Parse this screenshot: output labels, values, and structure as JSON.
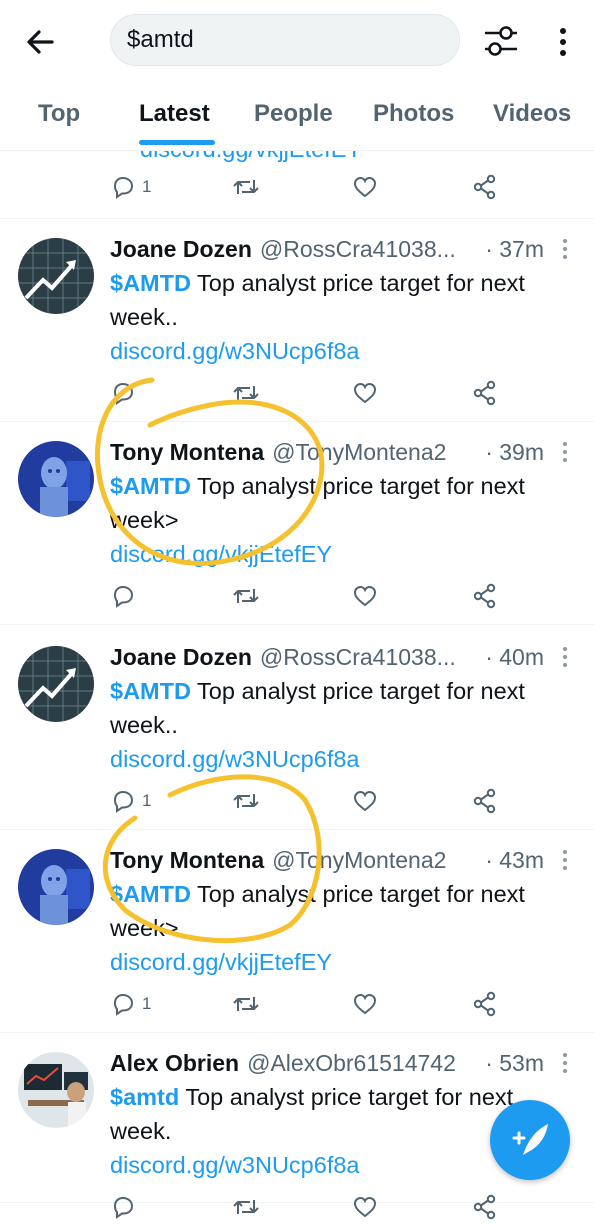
{
  "search": {
    "value": "$amtd"
  },
  "tabs": [
    {
      "label": "Top"
    },
    {
      "label": "Latest",
      "active": true
    },
    {
      "label": "People"
    },
    {
      "label": "Photos"
    },
    {
      "label": "Videos"
    }
  ],
  "colors": {
    "accent": "#1d9bf0",
    "annotation": "#f5c12f",
    "muted": "#536471"
  },
  "partial_tweet": {
    "link": "discord.gg/vkjjEtefEY",
    "reply_count": "1"
  },
  "tweets": [
    {
      "name": "Joane Dozen",
      "handle": "@RossCra41038...",
      "time": "· 37m",
      "cashtag": "$AMTD",
      "text1": " Top analyst price target for next",
      "text2": "week..",
      "link": "discord.gg/w3NUcp6f8a",
      "reply_count": "",
      "avatar_icon": "stock-chart-avatar"
    },
    {
      "name": "Tony Montena",
      "handle": "@TonyMontena2",
      "time": "· 39m",
      "cashtag": "$AMTD",
      "text1": " Top analyst price target for next",
      "text2": "week>",
      "link": "discord.gg/vkjjEtefEY",
      "reply_count": "",
      "avatar_icon": "meme-statue-avatar"
    },
    {
      "name": "Joane Dozen",
      "handle": "@RossCra41038...",
      "time": "· 40m",
      "cashtag": "$AMTD",
      "text1": " Top analyst price target for next",
      "text2": "week..",
      "link": "discord.gg/w3NUcp6f8a",
      "reply_count": "1",
      "avatar_icon": "stock-chart-avatar"
    },
    {
      "name": "Tony Montena",
      "handle": "@TonyMontena2",
      "time": "· 43m",
      "cashtag": "$AMTD",
      "text1": " Top analyst price target for next",
      "text2": "week>",
      "link": "discord.gg/vkjjEtefEY",
      "reply_count": "1",
      "avatar_icon": "meme-statue-avatar"
    },
    {
      "name": "Alex Obrien",
      "handle": "@AlexObr61514742",
      "time": "· 53m",
      "cashtag": "$amtd",
      "text1": " Top analyst price target for next",
      "text2": "week.",
      "link": "discord.gg/w3NUcp6f8a",
      "reply_count": "",
      "avatar_icon": "trader-desk-avatar"
    }
  ]
}
